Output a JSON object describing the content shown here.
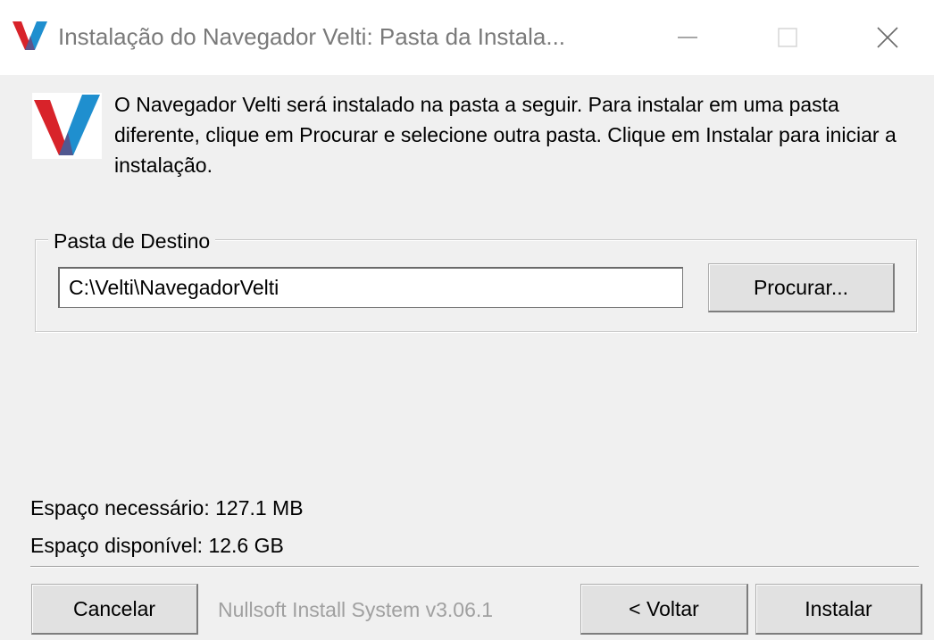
{
  "window": {
    "title": "Instalação do Navegador Velti: Pasta da Instala...",
    "controls": [
      "minimize-icon",
      "maximize-icon",
      "close-icon"
    ]
  },
  "header": {
    "description": "O Navegador Velti será instalado na pasta a seguir. Para instalar em uma pasta diferente, clique em Procurar e selecione outra pasta. Clique em Instalar para iniciar a instalação."
  },
  "destination": {
    "group_label": "Pasta de Destino",
    "path_value": "C:\\Velti\\NavegadorVelti",
    "browse_label": "Procurar..."
  },
  "space": {
    "required": "Espaço necessário: 127.1 MB",
    "available": "Espaço disponível: 12.6 GB"
  },
  "footer": {
    "cancel_label": "Cancelar",
    "brand": "Nullsoft Install System v3.06.1",
    "back_label": "< Voltar",
    "install_label": "Instalar"
  },
  "colors": {
    "logo_red": "#d8232a",
    "logo_blue": "#1f8fcf",
    "dialog_bg": "#f0f0f0",
    "button_bg": "#e1e1e1"
  }
}
